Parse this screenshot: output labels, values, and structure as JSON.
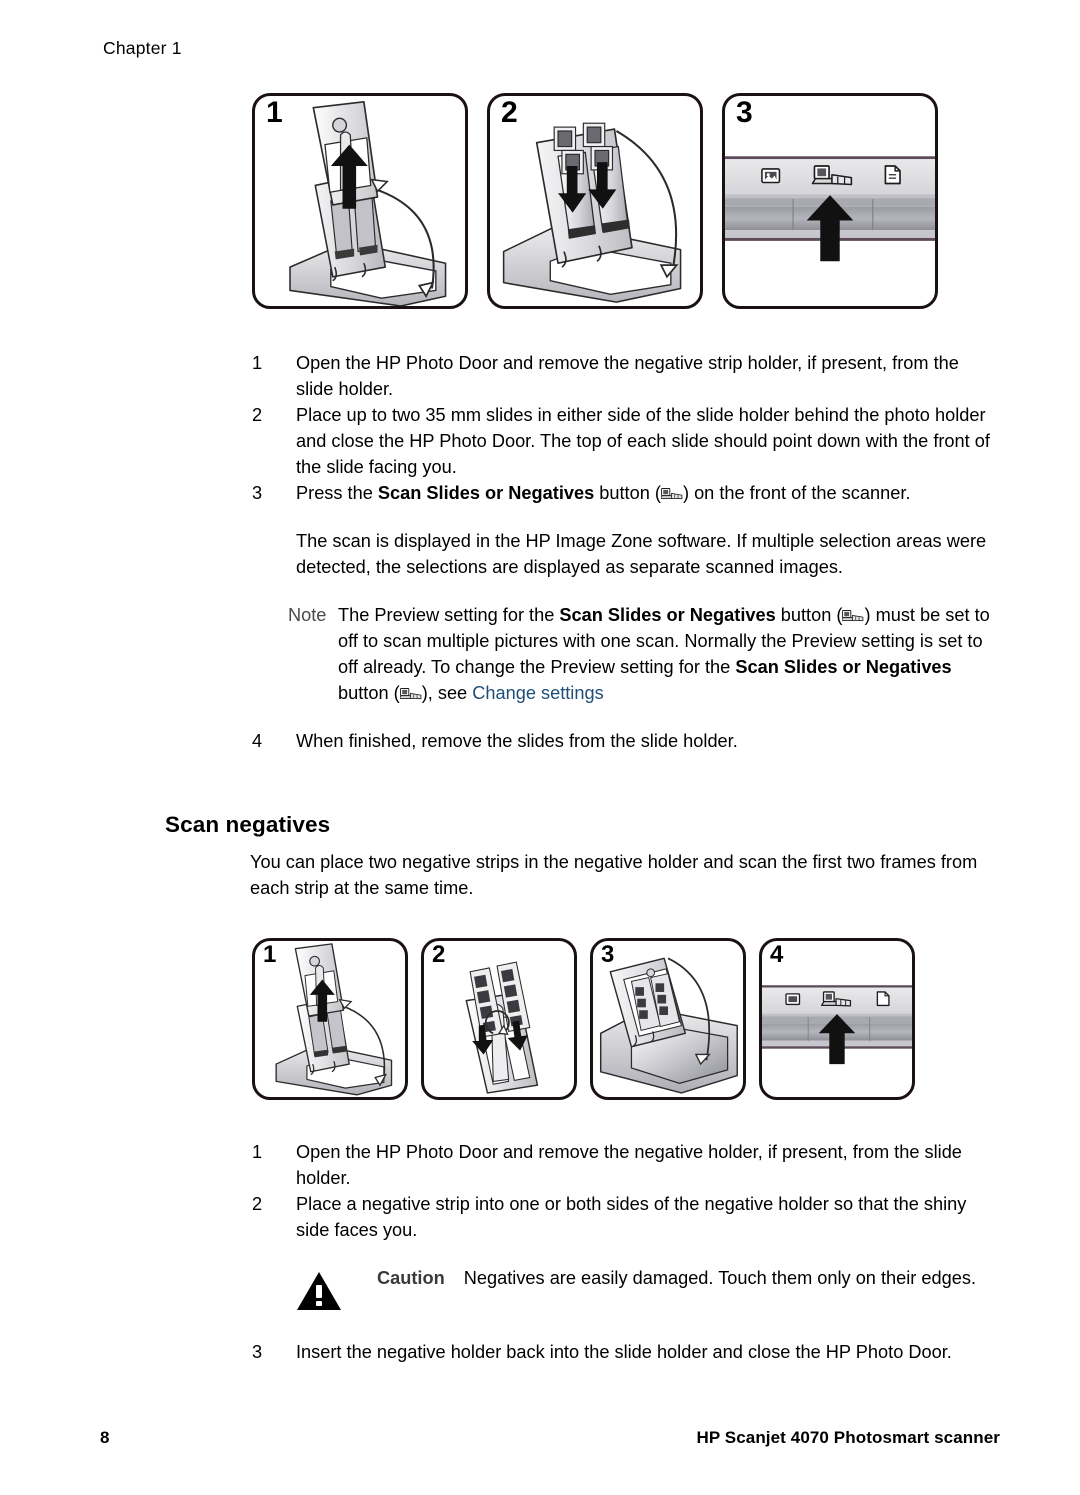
{
  "header": {
    "chapter": "Chapter 1"
  },
  "figures": {
    "slides_panels": [
      {
        "number": "1",
        "art": "slide-holder-removed-from-photo-door"
      },
      {
        "number": "2",
        "art": "slides-inserted-into-slide-holder"
      },
      {
        "number": "3",
        "art": "scanner-front-panel-scan-slides-button"
      }
    ],
    "negatives_panels": [
      {
        "number": "1",
        "art": "negative-holder-removed-from-slide-holder"
      },
      {
        "number": "2",
        "art": "negative-strips-inserted-into-holder"
      },
      {
        "number": "3",
        "art": "negative-holder-back-into-slide-holder"
      },
      {
        "number": "4",
        "art": "scanner-front-panel-scan-slides-button"
      }
    ]
  },
  "slides_steps": [
    {
      "num": "1",
      "text": "Open the HP Photo Door and remove the negative strip holder, if present, from the slide holder."
    },
    {
      "num": "2",
      "text": "Place up to two 35 mm slides in either side of the slide holder behind the photo holder and close the HP Photo Door. The top of each slide should point down with the front of the slide facing you."
    },
    {
      "num": "3",
      "text_before": "Press the ",
      "bold": "Scan Slides or Negatives",
      "text_mid": " button (",
      "text_after": ") on the front of the scanner."
    }
  ],
  "slides_result": "The scan is displayed in the HP Image Zone software. If multiple selection areas were detected, the selections are displayed as separate scanned images.",
  "note": {
    "label": "Note",
    "p1": "The Preview setting for the ",
    "b1": "Scan Slides or Negatives",
    "p2": " button (",
    "p3": ") must be set to off to scan multiple pictures with one scan. Normally the Preview setting is set to off already. To change the Preview setting for the ",
    "b2": "Scan Slides or Negatives",
    "p4": " button (",
    "p5": "), see ",
    "link": "Change settings"
  },
  "slides_step4": {
    "num": "4",
    "text": "When finished, remove the slides from the slide holder."
  },
  "scan_negatives": {
    "heading": "Scan negatives",
    "intro": "You can place two negative strips in the negative holder and scan the first two frames from each strip at the same time."
  },
  "negatives_steps": [
    {
      "num": "1",
      "text": "Open the HP Photo Door and remove the negative holder, if present, from the slide holder."
    },
    {
      "num": "2",
      "text": "Place a negative strip into one or both sides of the negative holder so that the shiny side faces you."
    },
    {
      "num": "3",
      "text": "Insert the negative holder back into the slide holder and close the HP Photo Door."
    }
  ],
  "caution": {
    "label": "Caution",
    "text": "Negatives are easily damaged. Touch them only on their edges."
  },
  "footer": {
    "page_number": "8",
    "product": "HP Scanjet 4070 Photosmart scanner"
  },
  "colors": {
    "link": "#1f4e79",
    "note_label": "#4a4a4a",
    "panel_border": "#1a1113",
    "text": "#000000"
  }
}
